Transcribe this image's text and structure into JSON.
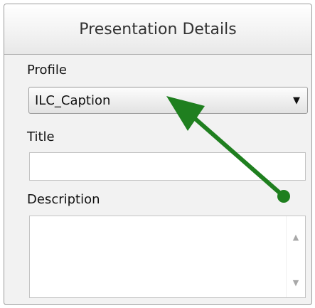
{
  "panel": {
    "title": "Presentation Details"
  },
  "profile": {
    "label": "Profile",
    "selected_value": "ILC_Caption",
    "caret_icon": "dropdown-caret-icon"
  },
  "title_field": {
    "label": "Title",
    "value": "",
    "placeholder": ""
  },
  "description_field": {
    "label": "Description",
    "value": "",
    "placeholder": ""
  },
  "scrollbar": {
    "up_icon": "scroll-up-arrow-icon",
    "down_icon": "scroll-down-arrow-icon"
  },
  "annotation": {
    "icon": "pointer-arrow-icon",
    "color": "#1f7f1f"
  },
  "colors": {
    "panel_background": "#f2f2f2",
    "header_gradient_top": "#ffffff",
    "header_gradient_bottom": "#e8e8e8",
    "annotation_arrow": "#1f7f1f"
  }
}
